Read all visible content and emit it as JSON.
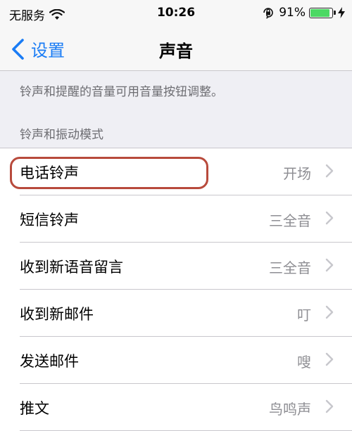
{
  "status_bar": {
    "carrier": "无服务",
    "time": "10:26",
    "battery_percent": "91%",
    "battery_level": 0.91,
    "battery_color": "#4cd964"
  },
  "nav": {
    "back_label": "设置",
    "title": "声音",
    "accent_color": "#1a7cf5"
  },
  "volume_note": "铃声和提醒的音量可用音量按钮调整。",
  "section_header": "铃声和振动模式",
  "rows": [
    {
      "label": "电话铃声",
      "value": "开场",
      "highlighted": true
    },
    {
      "label": "短信铃声",
      "value": "三全音"
    },
    {
      "label": "收到新语音留言",
      "value": "三全音"
    },
    {
      "label": "收到新邮件",
      "value": "叮"
    },
    {
      "label": "发送邮件",
      "value": "嗖"
    },
    {
      "label": "推文",
      "value": "鸟鸣声"
    }
  ]
}
